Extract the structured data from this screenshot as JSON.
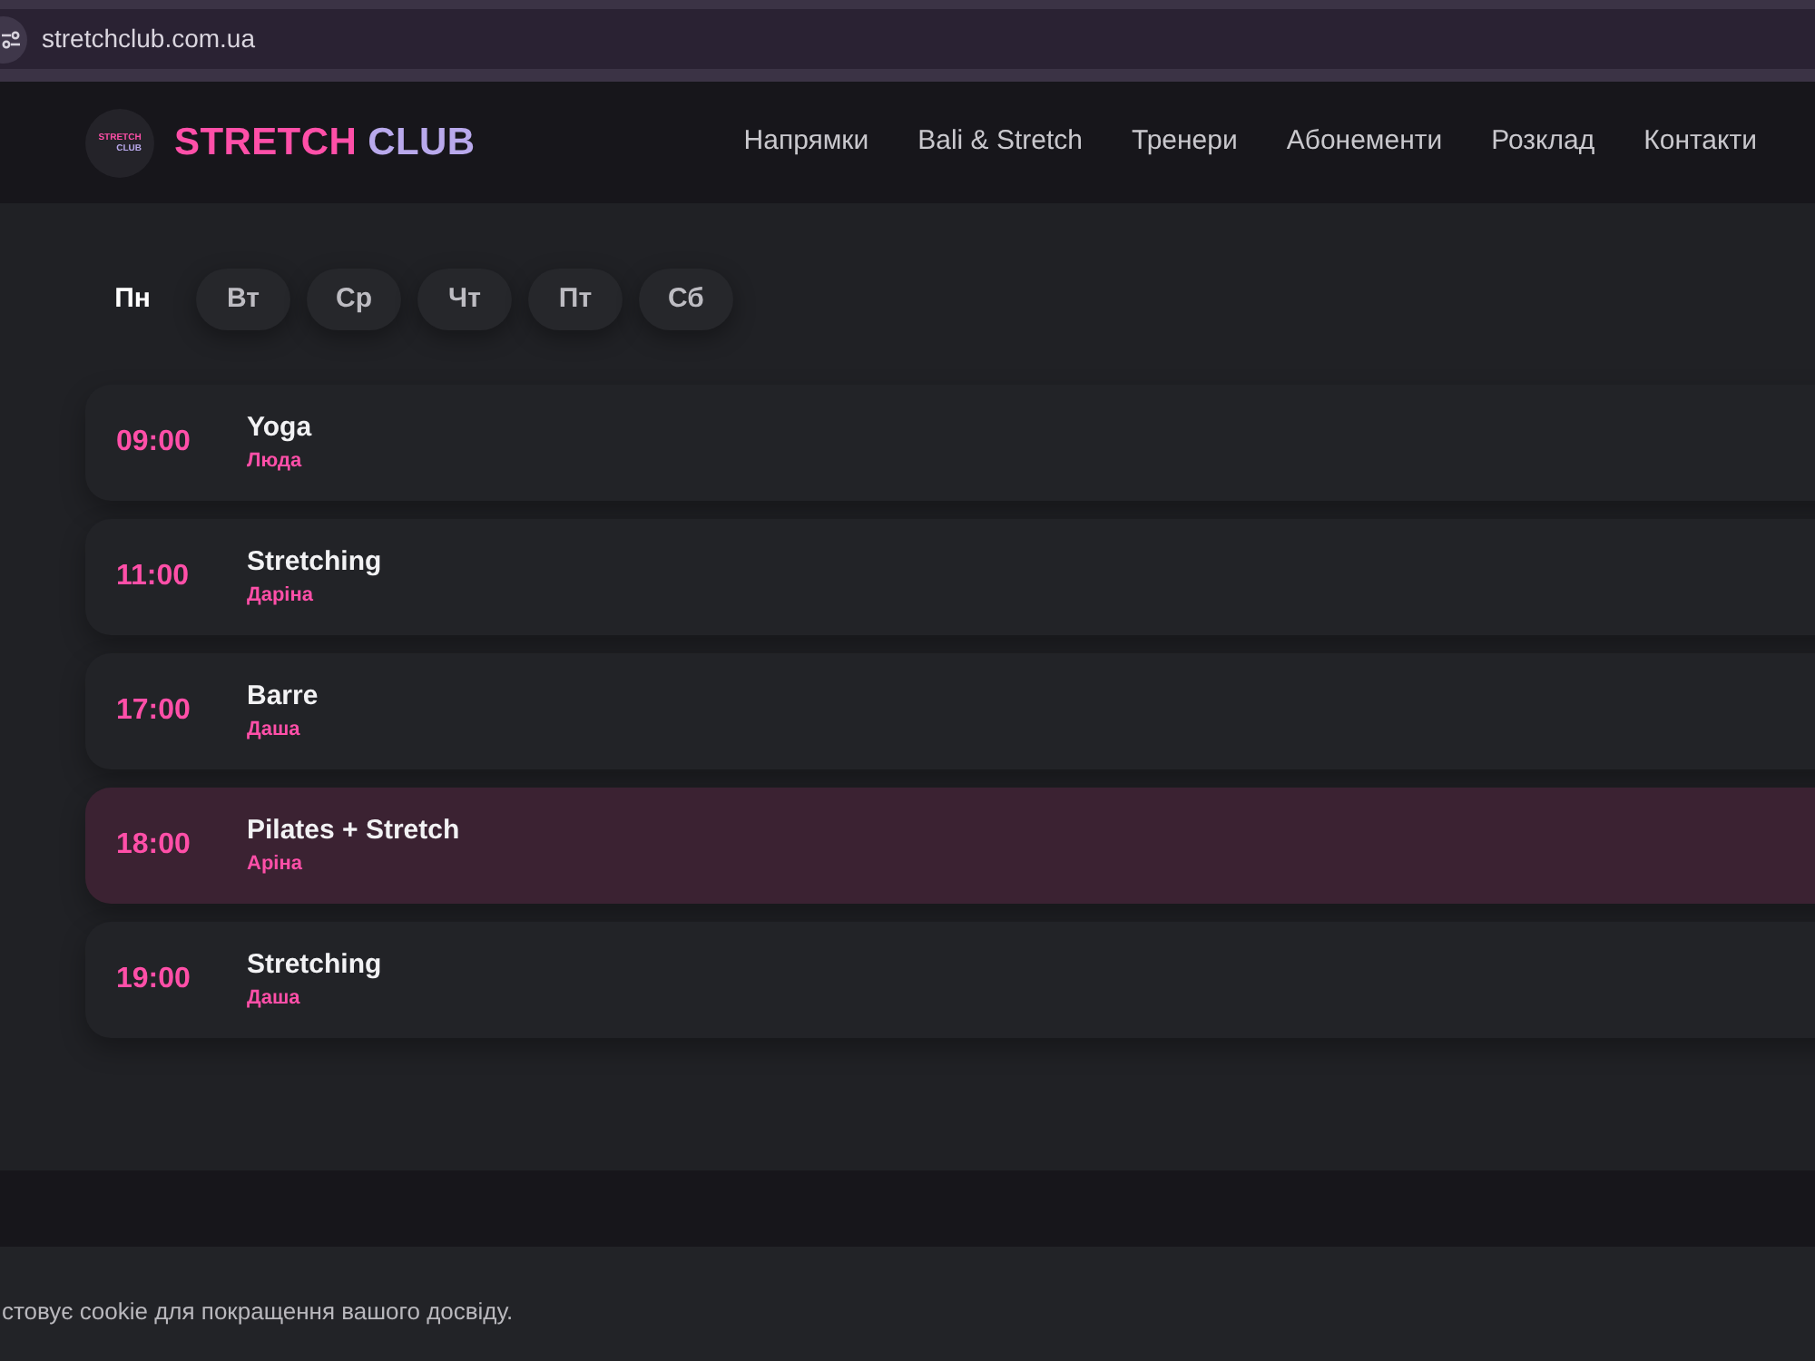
{
  "browser": {
    "url": "stretchclub.com.ua"
  },
  "header": {
    "logo_badge": {
      "line_1": "STRETCH",
      "line_2": "CLUB"
    },
    "brand": {
      "word_1": "STRETCH",
      "word_2": "CLUB"
    },
    "nav": [
      "Напрямки",
      "Bali & Stretch",
      "Тренери",
      "Абонементи",
      "Розклад",
      "Контакти"
    ]
  },
  "schedule": {
    "days": [
      {
        "label": "Пн",
        "selected": true
      },
      {
        "label": "Вт",
        "selected": false
      },
      {
        "label": "Ср",
        "selected": false
      },
      {
        "label": "Чт",
        "selected": false
      },
      {
        "label": "Пт",
        "selected": false
      },
      {
        "label": "Сб",
        "selected": false
      }
    ],
    "classes": [
      {
        "time": "09:00",
        "title": "Yoga",
        "instructor": "Люда",
        "highlighted": false
      },
      {
        "time": "11:00",
        "title": "Stretching",
        "instructor": "Даріна",
        "highlighted": false
      },
      {
        "time": "17:00",
        "title": "Barre",
        "instructor": "Даша",
        "highlighted": false
      },
      {
        "time": "18:00",
        "title": "Pilates + Stretch",
        "instructor": "Аріна",
        "highlighted": true
      },
      {
        "time": "19:00",
        "title": "Stretching",
        "instructor": "Даша",
        "highlighted": false
      }
    ]
  },
  "cookie_notice": {
    "text": "стовує cookie для покращення вашого досвіду."
  }
}
